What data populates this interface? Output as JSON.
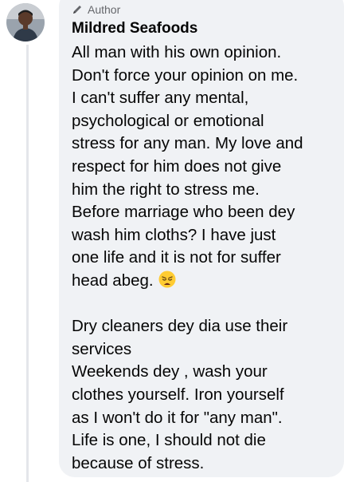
{
  "comment": {
    "author_badge": "Author",
    "author_name": "Mildred Seafoods",
    "paragraph1_lines": [
      "All man with his own opinion.",
      "Don't force your opinion on me.",
      "I can't suffer any mental,",
      "psychological or emotional",
      "stress for any man. My love and",
      "respect for him does not give",
      "him the right to stress me.",
      "Before marriage who been dey",
      "wash him cloths? I have just",
      "one life and it is not for suffer",
      "head abeg."
    ],
    "paragraph2_lines": [
      "Dry cleaners dey dia use their",
      "services",
      "Weekends dey , wash your",
      "clothes yourself. Iron yourself",
      "as I won't do it for \"any man\".",
      "Life is one, I should not die",
      "because of stress."
    ]
  },
  "icons": {
    "author_badge_icon": "pencil-icon",
    "emoji": "weary-face-emoji"
  },
  "colors": {
    "bubble_background": "#f0f2f5",
    "text_primary": "#050505",
    "text_secondary": "#65676b",
    "thread_line": "#e4e6eb"
  }
}
